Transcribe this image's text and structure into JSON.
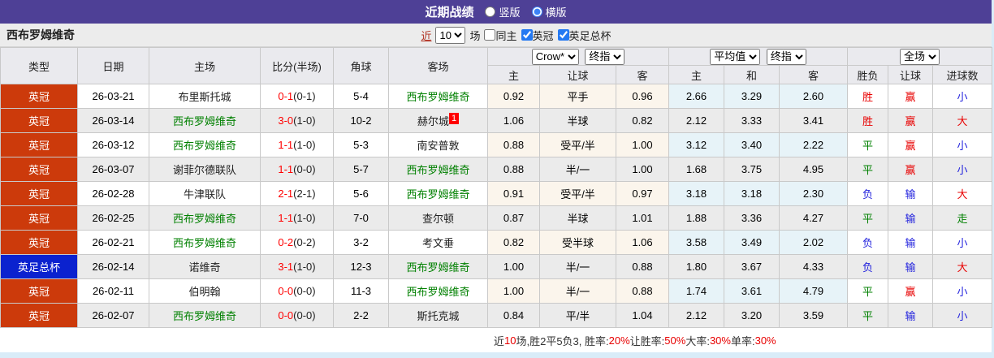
{
  "topbar": {
    "title": "近期战绩",
    "radio_vertical": "竖版",
    "radio_horizontal": "横版"
  },
  "filter": {
    "team": "西布罗姆维奇",
    "near_label": "近",
    "near_value": "10",
    "games_label": "场",
    "same_home": "同主",
    "league1": "英冠",
    "league2": "英足总杯"
  },
  "table": {
    "dropdowns": {
      "odds_source": "Crow*",
      "odds_type1": "终指",
      "avg": "平均值",
      "odds_type2": "终指",
      "scope": "全场"
    },
    "headers_main": [
      "类型",
      "日期",
      "主场",
      "比分(半场)",
      "角球",
      "客场"
    ],
    "headers_sub": [
      "主",
      "让球",
      "客",
      "主",
      "和",
      "客",
      "胜负",
      "让球",
      "进球数"
    ],
    "rows": [
      {
        "league": "英冠",
        "league_color": "red",
        "date": "26-03-21",
        "home": "布里斯托城",
        "home_green": false,
        "score": "0-1",
        "half": "(0-1)",
        "corner": "5-4",
        "away": "西布罗姆维奇",
        "away_green": true,
        "away_badge": "",
        "h": "0.92",
        "handicap": "平手",
        "a": "0.96",
        "avg_h": "2.66",
        "avg_d": "3.29",
        "avg_a": "2.60",
        "outcome": "胜",
        "outcome_color": "red",
        "let_result": "赢",
        "let_color": "red",
        "goals": "小",
        "goals_color": "blue"
      },
      {
        "league": "英冠",
        "league_color": "red",
        "date": "26-03-14",
        "home": "西布罗姆维奇",
        "home_green": true,
        "score": "3-0",
        "half": "(1-0)",
        "corner": "10-2",
        "away": "赫尔城",
        "away_green": false,
        "away_badge": "1",
        "h": "1.06",
        "handicap": "半球",
        "a": "0.82",
        "avg_h": "2.12",
        "avg_d": "3.33",
        "avg_a": "3.41",
        "outcome": "胜",
        "outcome_color": "red",
        "let_result": "赢",
        "let_color": "red",
        "goals": "大",
        "goals_color": "red"
      },
      {
        "league": "英冠",
        "league_color": "red",
        "date": "26-03-12",
        "home": "西布罗姆维奇",
        "home_green": true,
        "score": "1-1",
        "half": "(1-0)",
        "corner": "5-3",
        "away": "南安普敦",
        "away_green": false,
        "away_badge": "",
        "h": "0.88",
        "handicap": "受平/半",
        "a": "1.00",
        "avg_h": "3.12",
        "avg_d": "3.40",
        "avg_a": "2.22",
        "outcome": "平",
        "outcome_color": "green",
        "let_result": "赢",
        "let_color": "red",
        "goals": "小",
        "goals_color": "blue"
      },
      {
        "league": "英冠",
        "league_color": "red",
        "date": "26-03-07",
        "home": "谢菲尔德联队",
        "home_green": false,
        "score": "1-1",
        "half": "(0-0)",
        "corner": "5-7",
        "away": "西布罗姆维奇",
        "away_green": true,
        "away_badge": "",
        "h": "0.88",
        "handicap": "半/一",
        "a": "1.00",
        "avg_h": "1.68",
        "avg_d": "3.75",
        "avg_a": "4.95",
        "outcome": "平",
        "outcome_color": "green",
        "let_result": "赢",
        "let_color": "red",
        "goals": "小",
        "goals_color": "blue"
      },
      {
        "league": "英冠",
        "league_color": "red",
        "date": "26-02-28",
        "home": "牛津联队",
        "home_green": false,
        "score": "2-1",
        "half": "(2-1)",
        "corner": "5-6",
        "away": "西布罗姆维奇",
        "away_green": true,
        "away_badge": "",
        "h": "0.91",
        "handicap": "受平/半",
        "a": "0.97",
        "avg_h": "3.18",
        "avg_d": "3.18",
        "avg_a": "2.30",
        "outcome": "负",
        "outcome_color": "blue",
        "let_result": "输",
        "let_color": "blue",
        "goals": "大",
        "goals_color": "red"
      },
      {
        "league": "英冠",
        "league_color": "red",
        "date": "26-02-25",
        "home": "西布罗姆维奇",
        "home_green": true,
        "score": "1-1",
        "half": "(1-0)",
        "corner": "7-0",
        "away": "查尔顿",
        "away_green": false,
        "away_badge": "",
        "h": "0.87",
        "handicap": "半球",
        "a": "1.01",
        "avg_h": "1.88",
        "avg_d": "3.36",
        "avg_a": "4.27",
        "outcome": "平",
        "outcome_color": "green",
        "let_result": "输",
        "let_color": "blue",
        "goals": "走",
        "goals_color": "green"
      },
      {
        "league": "英冠",
        "league_color": "red",
        "date": "26-02-21",
        "home": "西布罗姆维奇",
        "home_green": true,
        "score": "0-2",
        "half": "(0-2)",
        "corner": "3-2",
        "away": "考文垂",
        "away_green": false,
        "away_badge": "",
        "h": "0.82",
        "handicap": "受半球",
        "a": "1.06",
        "avg_h": "3.58",
        "avg_d": "3.49",
        "avg_a": "2.02",
        "outcome": "负",
        "outcome_color": "blue",
        "let_result": "输",
        "let_color": "blue",
        "goals": "小",
        "goals_color": "blue"
      },
      {
        "league": "英足总杯",
        "league_color": "blue",
        "date": "26-02-14",
        "home": "诺维奇",
        "home_green": false,
        "score": "3-1",
        "half": "(1-0)",
        "corner": "12-3",
        "away": "西布罗姆维奇",
        "away_green": true,
        "away_badge": "",
        "h": "1.00",
        "handicap": "半/一",
        "a": "0.88",
        "avg_h": "1.80",
        "avg_d": "3.67",
        "avg_a": "4.33",
        "outcome": "负",
        "outcome_color": "blue",
        "let_result": "输",
        "let_color": "blue",
        "goals": "大",
        "goals_color": "red"
      },
      {
        "league": "英冠",
        "league_color": "red",
        "date": "26-02-11",
        "home": "伯明翰",
        "home_green": false,
        "score": "0-0",
        "half": "(0-0)",
        "corner": "11-3",
        "away": "西布罗姆维奇",
        "away_green": true,
        "away_badge": "",
        "h": "1.00",
        "handicap": "半/一",
        "a": "0.88",
        "avg_h": "1.74",
        "avg_d": "3.61",
        "avg_a": "4.79",
        "outcome": "平",
        "outcome_color": "green",
        "let_result": "赢",
        "let_color": "red",
        "goals": "小",
        "goals_color": "blue"
      },
      {
        "league": "英冠",
        "league_color": "red",
        "date": "26-02-07",
        "home": "西布罗姆维奇",
        "home_green": true,
        "score": "0-0",
        "half": "(0-0)",
        "corner": "2-2",
        "away": "斯托克城",
        "away_green": false,
        "away_badge": "",
        "h": "0.84",
        "handicap": "平/半",
        "a": "1.04",
        "avg_h": "2.12",
        "avg_d": "3.20",
        "avg_a": "3.59",
        "outcome": "平",
        "outcome_color": "green",
        "let_result": "输",
        "let_color": "blue",
        "goals": "小",
        "goals_color": "blue"
      }
    ]
  },
  "footer": {
    "segments": [
      {
        "t": "近",
        "c": "k"
      },
      {
        "t": "10",
        "c": "r"
      },
      {
        "t": "场,胜2平5负3, 胜率:",
        "c": "k"
      },
      {
        "t": "20%",
        "c": "r"
      },
      {
        "t": " 让胜率:",
        "c": "k"
      },
      {
        "t": "50%",
        "c": "r"
      },
      {
        "t": " 大率:",
        "c": "k"
      },
      {
        "t": "30%",
        "c": "r"
      },
      {
        "t": " 单率:",
        "c": "k"
      },
      {
        "t": "30%",
        "c": "r"
      }
    ]
  }
}
